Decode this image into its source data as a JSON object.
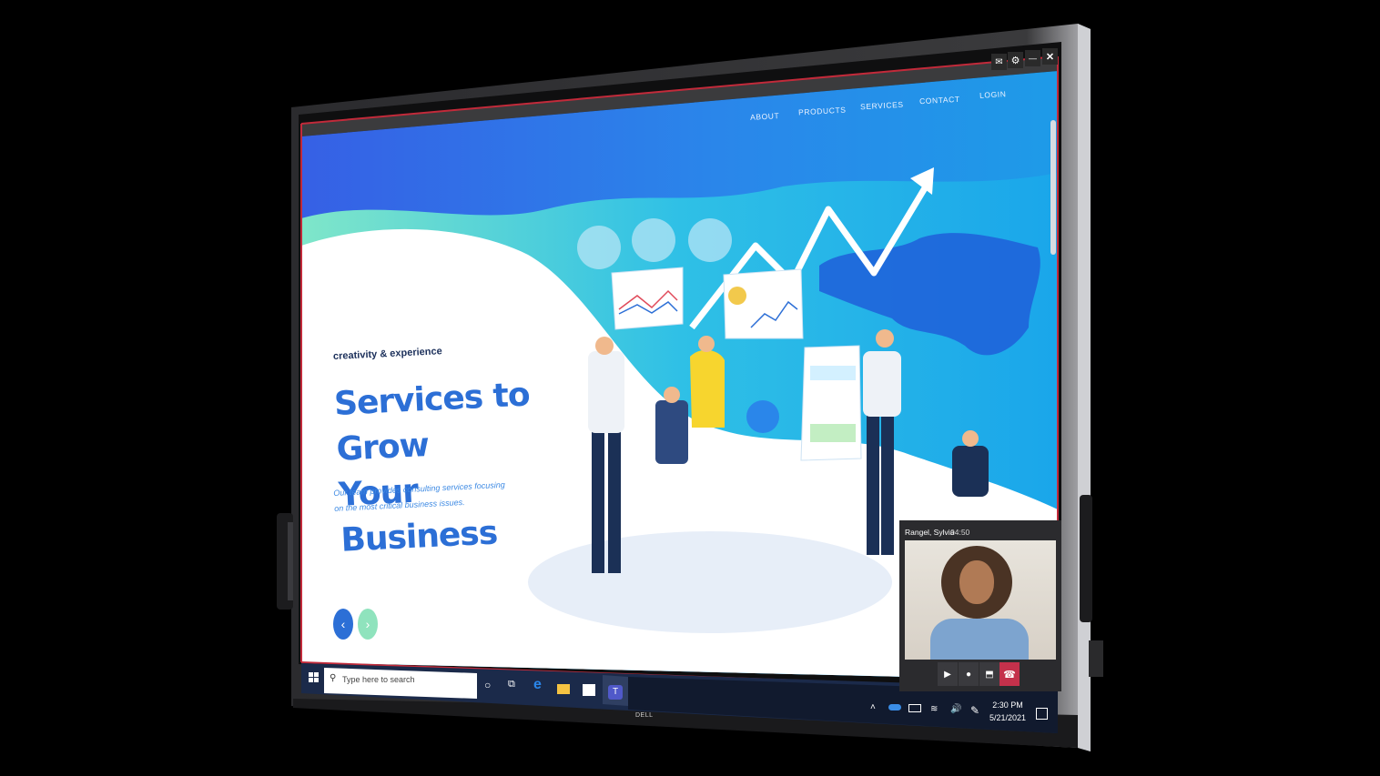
{
  "window_controls": {
    "mail_icon": "mail-icon",
    "settings_icon": "gear-icon",
    "minimize_label": "—",
    "close_label": "✕"
  },
  "website": {
    "nav": [
      "ABOUT",
      "PRODUCTS",
      "SERVICES",
      "CONTACT",
      "LOGIN"
    ],
    "kicker": "creativity & experience",
    "title_line1": "Services to Grow",
    "title_line2": "Your Business",
    "subtitle_line1": "Our team provides consulting services focusing",
    "subtitle_line2": "on the most critical business issues.",
    "prev_label": "‹",
    "next_label": "›",
    "colors": {
      "accent": "#2c6fd6",
      "wave_top": "#3a63e6",
      "wave_mid": "#24b4e8",
      "mint": "#7de3c8"
    }
  },
  "taskbar": {
    "search_placeholder": "Type here to search",
    "time": "2:30 PM",
    "date": "5/21/2021",
    "icons": [
      "windows-start-icon",
      "search-icon",
      "cortana-icon",
      "task-view-icon",
      "edge-icon",
      "file-explorer-icon",
      "store-icon",
      "teams-icon"
    ]
  },
  "call": {
    "name": "Rangel, Sylvia",
    "duration": "04:50",
    "controls": [
      "camera-icon",
      "mic-icon",
      "share-screen-icon",
      "hang-up-icon"
    ],
    "colors": {
      "hangup": "#c4314b"
    }
  },
  "brand": "DELL"
}
